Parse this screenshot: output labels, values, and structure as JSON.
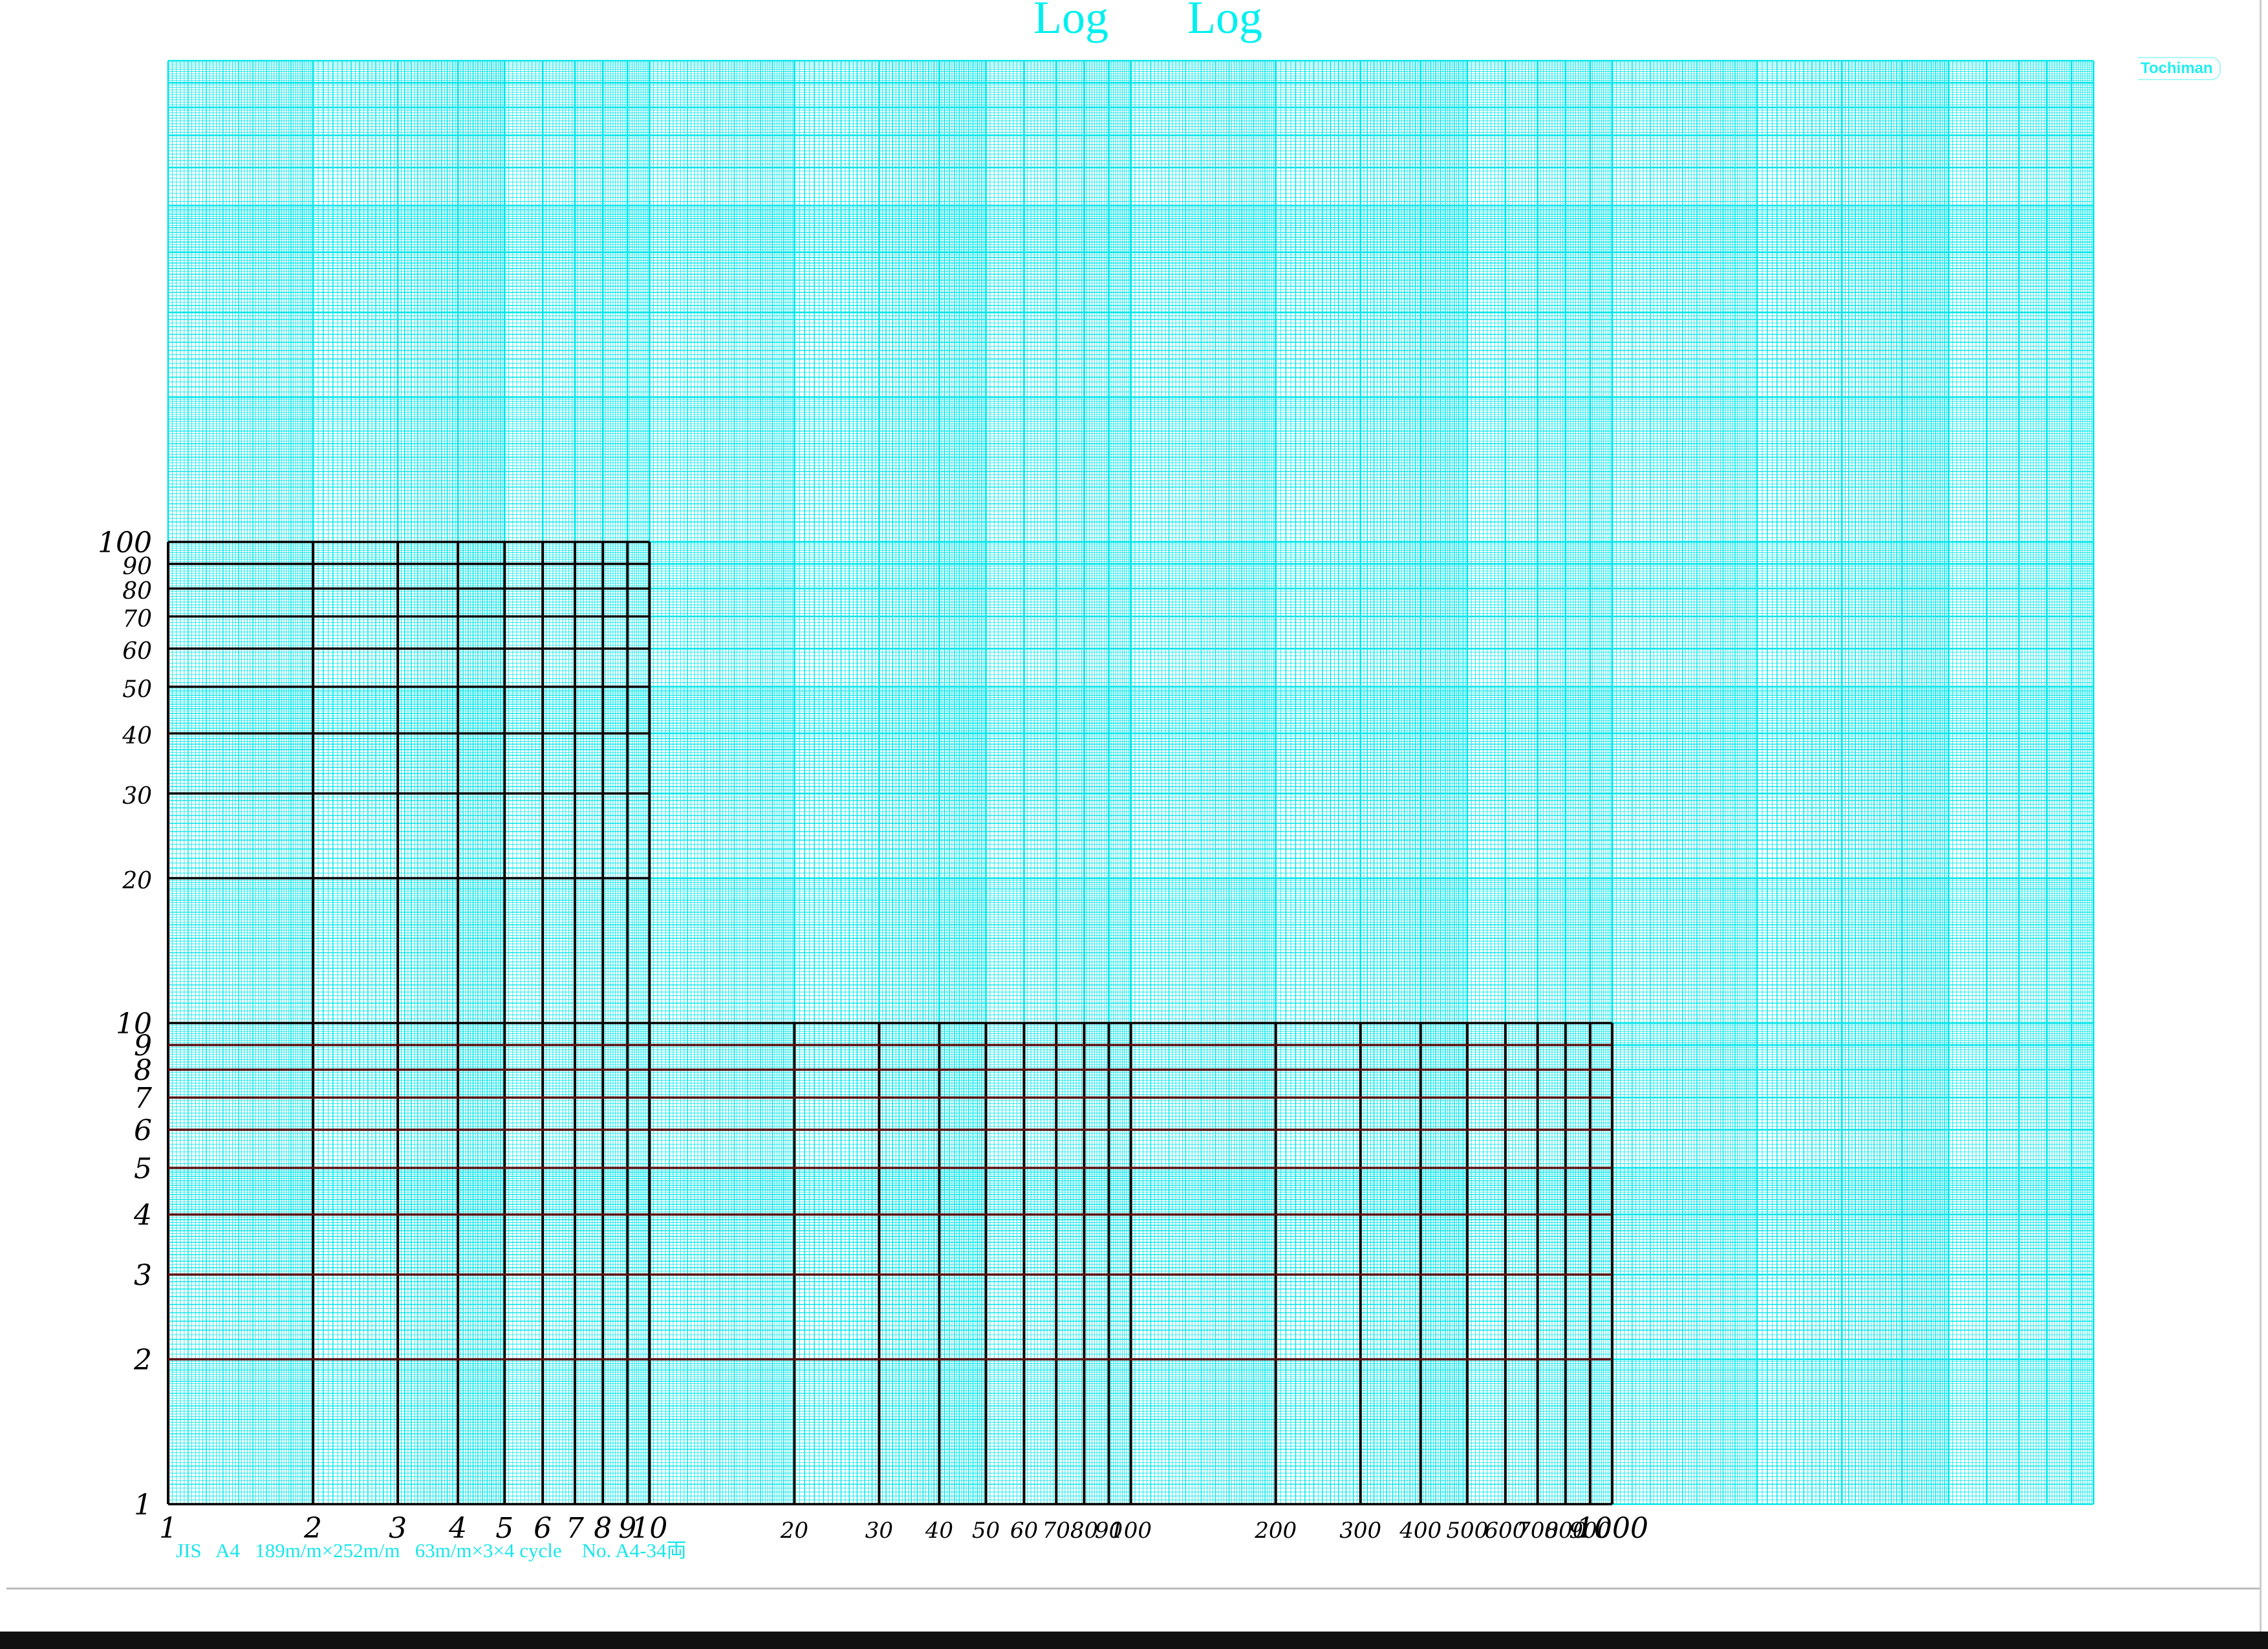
{
  "header": {
    "titles": [
      "Log",
      "Log"
    ],
    "brand": "Tochiman"
  },
  "footer": {
    "spec": "JIS   A4   189m/m×252m/m   63m/m×3×4 cycle    No. A4-34両"
  },
  "colors": {
    "paper_grid": "#00e5ea",
    "ink": "#000000",
    "red_ink": "#5a1010",
    "background": "#ffffff"
  },
  "chart_data": {
    "type": "line",
    "xscale": "log",
    "yscale": "log",
    "paper_cycles": {
      "x": 4,
      "y": 3
    },
    "xlim": [
      1,
      10000
    ],
    "ylim": [
      1,
      1000
    ],
    "grid": true,
    "hand_grid": {
      "left_block": {
        "x": [
          1,
          10
        ],
        "y": [
          1,
          100
        ]
      },
      "right_block": {
        "x": [
          10,
          1000
        ],
        "y": [
          1,
          10
        ]
      }
    },
    "x_tick_labels": [
      "1",
      "2",
      "3",
      "4",
      "5",
      "6",
      "7",
      "8",
      "9",
      "10",
      "20",
      "30",
      "40",
      "50",
      "60",
      "70",
      "80",
      "90",
      "100",
      "200",
      "300",
      "400",
      "500",
      "600",
      "700",
      "800",
      "900",
      "1000"
    ],
    "x_tick_values": [
      1,
      2,
      3,
      4,
      5,
      6,
      7,
      8,
      9,
      10,
      20,
      30,
      40,
      50,
      60,
      70,
      80,
      90,
      100,
      200,
      300,
      400,
      500,
      600,
      700,
      800,
      900,
      1000
    ],
    "y_tick_labels": [
      "1",
      "2",
      "3",
      "4",
      "5",
      "6",
      "7",
      "8",
      "9",
      "10",
      "20",
      "30",
      "40",
      "50",
      "60",
      "70",
      "80",
      "90",
      "100"
    ],
    "y_tick_values": [
      1,
      2,
      3,
      4,
      5,
      6,
      7,
      8,
      9,
      10,
      20,
      30,
      40,
      50,
      60,
      70,
      80,
      90,
      100
    ],
    "series": []
  }
}
